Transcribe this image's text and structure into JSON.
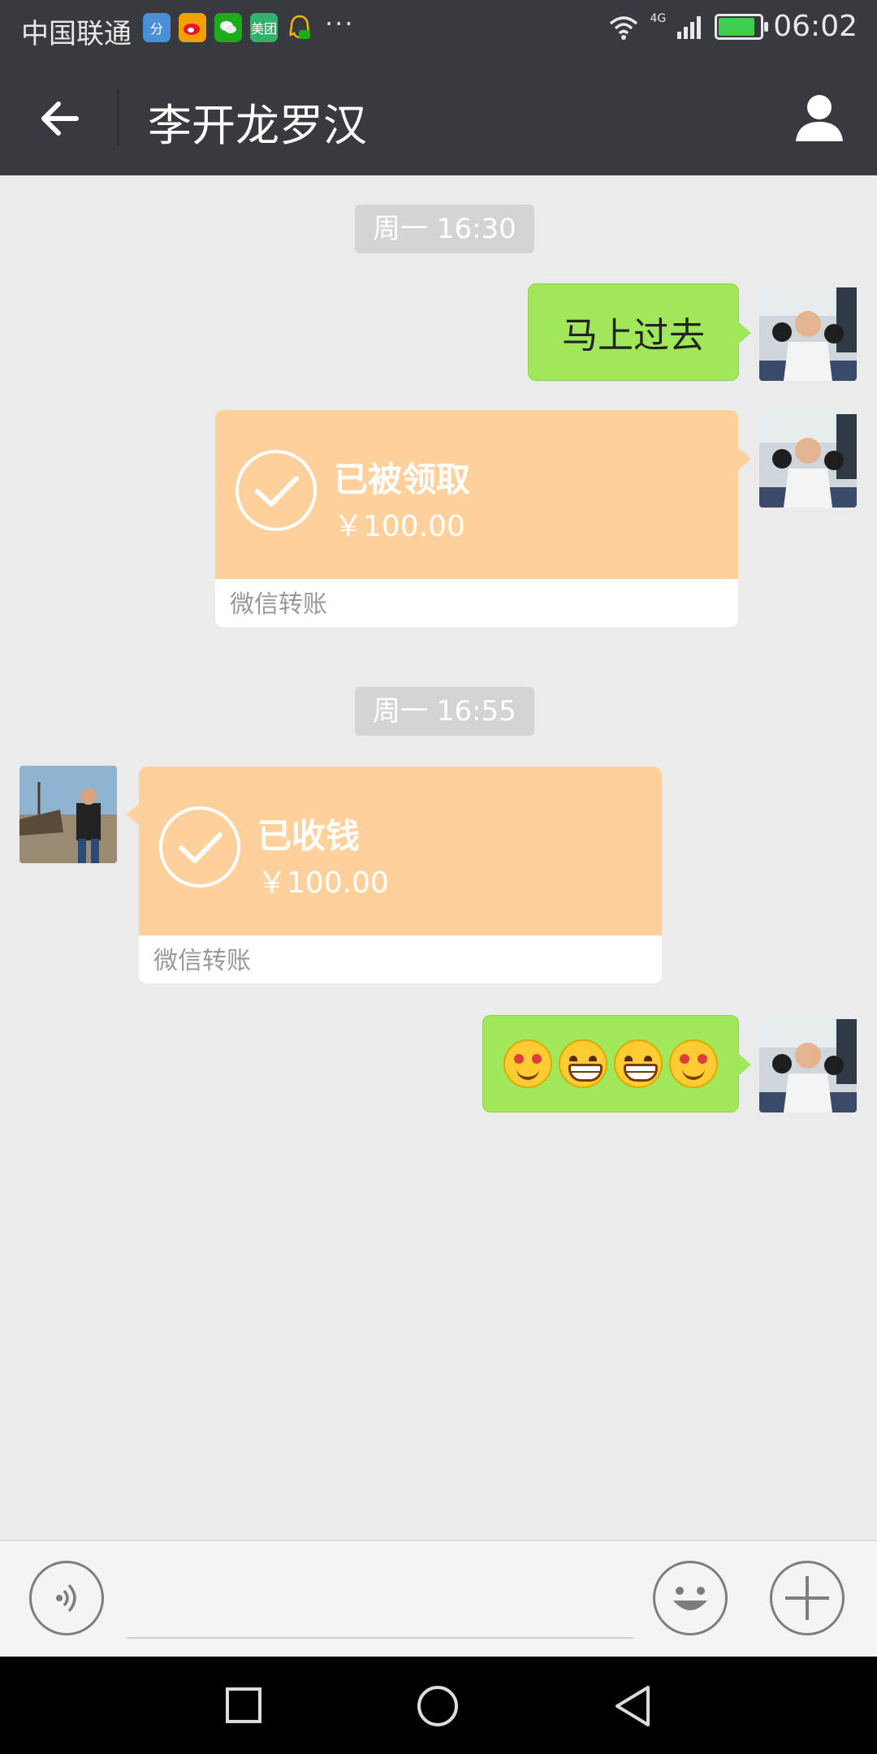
{
  "status_bar": {
    "carrier": "中国联通",
    "more": "···",
    "network": "4G",
    "time": "06:02",
    "notification_icons": [
      "baidu-icon",
      "weibo-icon",
      "wechat-icon",
      "meituan-icon",
      "qq-icon"
    ],
    "notification_labels": [
      "分",
      "",
      "",
      "美团",
      ""
    ]
  },
  "nav": {
    "title": "李开龙罗汉"
  },
  "chat": {
    "timestamps": [
      "周一 16:30",
      "周一 16:55"
    ],
    "msg1": {
      "text": "马上过去"
    },
    "transfer1": {
      "status": "已被领取",
      "amount": "￥100.00",
      "footer": "微信转账"
    },
    "transfer2": {
      "status": "已收钱",
      "amount": "￥100.00",
      "footer": "微信转账"
    },
    "emoji_message": [
      "smiling-face-with-heart-eyes",
      "grinning-face",
      "grinning-face",
      "smiling-face-with-heart-eyes"
    ]
  },
  "colors": {
    "nav_bg": "#393a3f",
    "chat_bg": "#ebebeb",
    "bubble_green": "#a0e75a",
    "transfer_orange": "#fed19c"
  }
}
